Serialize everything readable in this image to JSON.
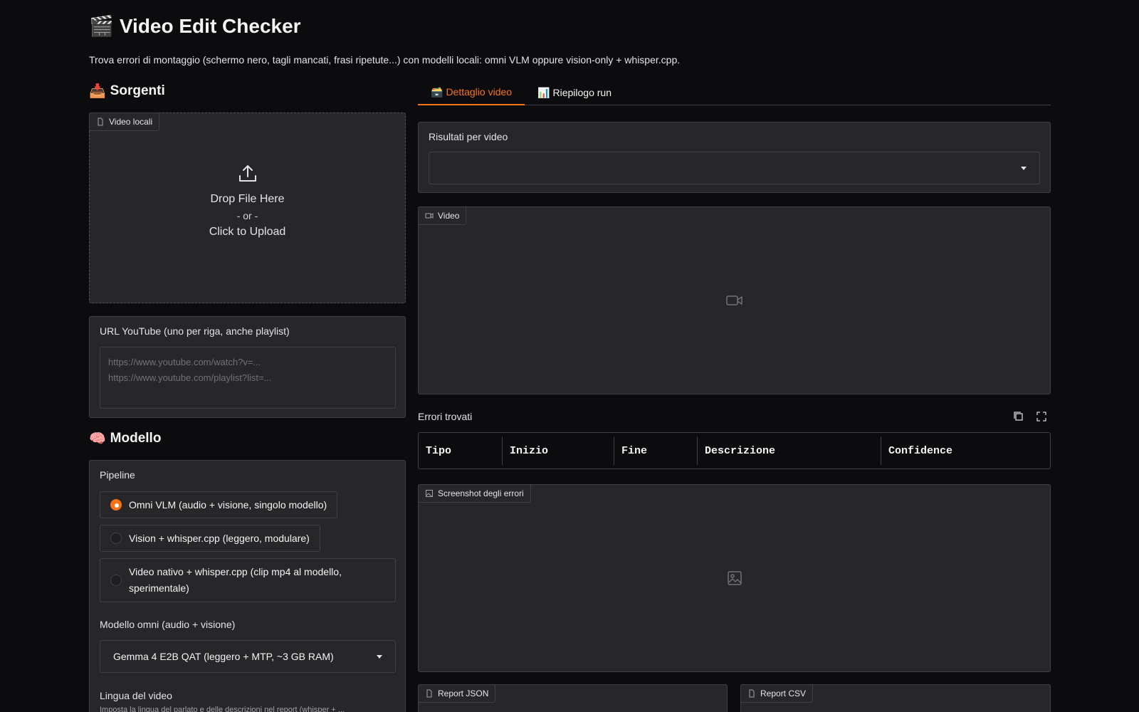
{
  "header": {
    "icon": "🎬",
    "title": "Video Edit Checker",
    "subtitle": "Trova errori di montaggio (schermo nero, tagli mancati, frasi ripetute...) con modelli locali: omni VLM oppure vision-only + whisper.cpp."
  },
  "sources": {
    "icon": "📥",
    "heading": "Sorgenti",
    "upload": {
      "tag": "Video locali",
      "drop": "Drop File Here",
      "or": "- or -",
      "click": "Click to Upload"
    },
    "youtube": {
      "label": "URL YouTube (uno per riga, anche playlist)",
      "placeholder": "https://www.youtube.com/watch?v=...\nhttps://www.youtube.com/playlist?list=..."
    }
  },
  "model": {
    "icon": "🧠",
    "heading": "Modello",
    "pipeline_label": "Pipeline",
    "options": [
      {
        "label": "Omni VLM (audio + visione, singolo modello)",
        "selected": true
      },
      {
        "label": "Vision + whisper.cpp (leggero, modulare)",
        "selected": false
      },
      {
        "label": "Video nativo + whisper.cpp (clip mp4 al modello, sperimentale)",
        "selected": false
      }
    ],
    "omni_label": "Modello omni (audio + visione)",
    "omni_value": "Gemma 4 E2B QAT (leggero + MTP, ~3 GB RAM)",
    "lang_label": "Lingua del video",
    "lang_info": "Imposta la lingua del parlato e delle descrizioni nel report (whisper + ..."
  },
  "tabs": [
    {
      "icon": "🗃️",
      "label": "Dettaglio video",
      "active": true
    },
    {
      "icon": "📊",
      "label": "Riepilogo run",
      "active": false
    }
  ],
  "results": {
    "label": "Risultati per video",
    "selected": ""
  },
  "video": {
    "tag": "Video"
  },
  "errors": {
    "label": "Errori trovati",
    "columns": [
      "Tipo",
      "Inizio",
      "Fine",
      "Descrizione",
      "Confidence"
    ]
  },
  "screenshots": {
    "tag": "Screenshot degli errori"
  },
  "reports": {
    "json_tag": "Report JSON",
    "csv_tag": "Report CSV"
  },
  "colors": {
    "accent": "#f97316",
    "background": "#0c0c0f",
    "panel": "#27272a",
    "border": "#3f3f46"
  }
}
